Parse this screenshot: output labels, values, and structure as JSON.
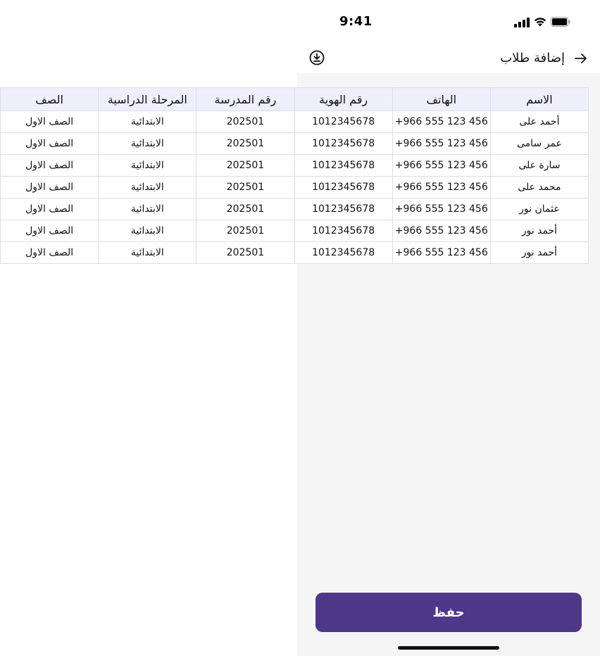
{
  "status_bar": {
    "time": "9:41"
  },
  "header": {
    "title": "إضافة طلاب"
  },
  "table": {
    "columns": [
      "الاسم",
      "الهاتف",
      "رقم الهوية",
      "رقم المدرسة",
      "المرحلة الدراسية",
      "الصف"
    ],
    "rows": [
      [
        "أحمد على",
        "+966 555 123 456",
        "1012345678",
        "202501",
        "الابتدائية",
        "الصف الاول"
      ],
      [
        "عمر سامى",
        "+966 555 123 456",
        "1012345678",
        "202501",
        "الابتدائية",
        "الصف الاول"
      ],
      [
        "سارة على",
        "+966 555 123 456",
        "1012345678",
        "202501",
        "الابتدائية",
        "الصف الاول"
      ],
      [
        "محمد على",
        "+966 555 123 456",
        "1012345678",
        "202501",
        "الابتدائية",
        "الصف الاول"
      ],
      [
        "عثمان نور",
        "+966 555 123 456",
        "1012345678",
        "202501",
        "الابتدائية",
        "الصف الاول"
      ],
      [
        "أحمد نور",
        "+966 555 123 456",
        "1012345678",
        "202501",
        "الابتدائية",
        "الصف الاول"
      ],
      [
        "أحمد نور",
        "+966 555 123 456",
        "1012345678",
        "202501",
        "الابتدائية",
        "الصف الاول"
      ]
    ]
  },
  "actions": {
    "save_label": "حفظ"
  },
  "colors": {
    "primary": "#4e3789",
    "header_row_bg": "#efeefb",
    "panel_bg": "#f5f5f6",
    "border": "#dcdcf0"
  },
  "icons": {
    "back": "arrow-right-icon",
    "download": "download-circle-icon"
  }
}
